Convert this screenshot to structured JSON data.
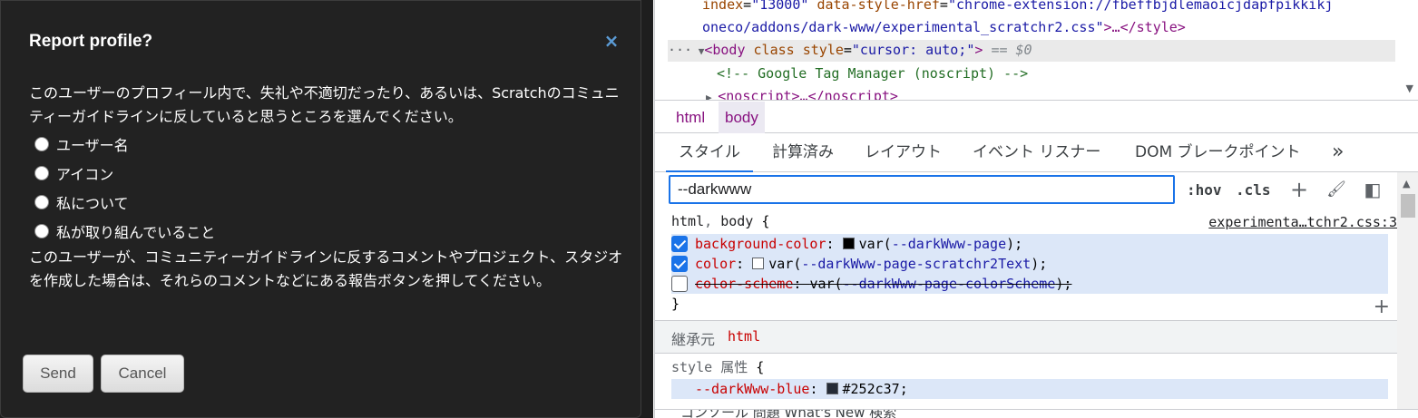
{
  "modal": {
    "title": "Report profile?",
    "close_icon": "×",
    "intro": "このユーザーのプロフィール内で、失礼や不適切だったり、あるいは、Scratchのコミュニティーガイドラインに反していると思うところを選んでください。",
    "options": [
      "ユーザー名",
      "アイコン",
      "私について",
      "私が取り組んでいること"
    ],
    "outro": "このユーザーが、コミュニティーガイドラインに反するコメントやプロジェクト、スタジオを作成した場合は、それらのコメントなどにある報告ボタンを押してください。",
    "send_label": "Send",
    "cancel_label": "Cancel"
  },
  "devtools": {
    "elements": {
      "line1_attr1": "index",
      "line1_val1": "\"13000\"",
      "line1_attr2": "data-style-href",
      "line1_val2": "\"chrome-extension://fbeffbjdlemaoicjdapfpikkikj",
      "line2_val": "oneco/addons/dark-www/experimental_scratchr2.css\"",
      "line2_tail": ">…</style>",
      "line3_dots": "···",
      "line3_tag_open": "<body",
      "line3_attr1": "class",
      "line3_attr2": "style",
      "line3_val2": "\"cursor: auto;\"",
      "line3_tag_close": ">",
      "line3_eq": "== $0",
      "line4_comment": "<!-- Google Tag Manager (noscript) -->",
      "line5_tag": "<noscript>…</noscript>"
    },
    "breadcrumbs": [
      "html",
      "body"
    ],
    "tabs": [
      "スタイル",
      "計算済み",
      "レイアウト",
      "イベント リスナー",
      "DOM ブレークポイント",
      "»"
    ],
    "filter": {
      "value": "--darkwww"
    },
    "toolbar": {
      "hov": ":hov",
      "cls": ".cls",
      "add_icon": "+",
      "paint_icon": "🖌",
      "sidebar_icon": "◧"
    },
    "rule1": {
      "selector_html": "html",
      "selector_sep": ", ",
      "selector_body": "body",
      "open_brace": " {",
      "source": "experimenta…tchr2.css:3",
      "declarations": [
        {
          "checked": true,
          "prop": "background-color",
          "swatch": "#000000",
          "value": "var(--darkWww-page)",
          "var": "--darkWww-page",
          "fn": "var"
        },
        {
          "checked": true,
          "prop": "color",
          "swatch": "#ffffff",
          "value": "var(--darkWww-page-scratchr2Text)",
          "var": "--darkWww-page-scratchr2Text",
          "fn": "var"
        },
        {
          "checked": false,
          "prop": "color-scheme",
          "value": "var(--darkWww-page-colorScheme)",
          "var": "--darkWww-page-colorScheme",
          "fn": "var"
        }
      ],
      "close_brace": "}"
    },
    "inherited": {
      "label": "継承元",
      "tag": "html"
    },
    "style_attr": {
      "selector": "style",
      "label": "属性",
      "open_brace": "{",
      "prop": "--darkWww-blue",
      "swatch": "#252c37",
      "value": "#252c37"
    },
    "drawer_text": "コンソール    問題    What's New    検索"
  }
}
